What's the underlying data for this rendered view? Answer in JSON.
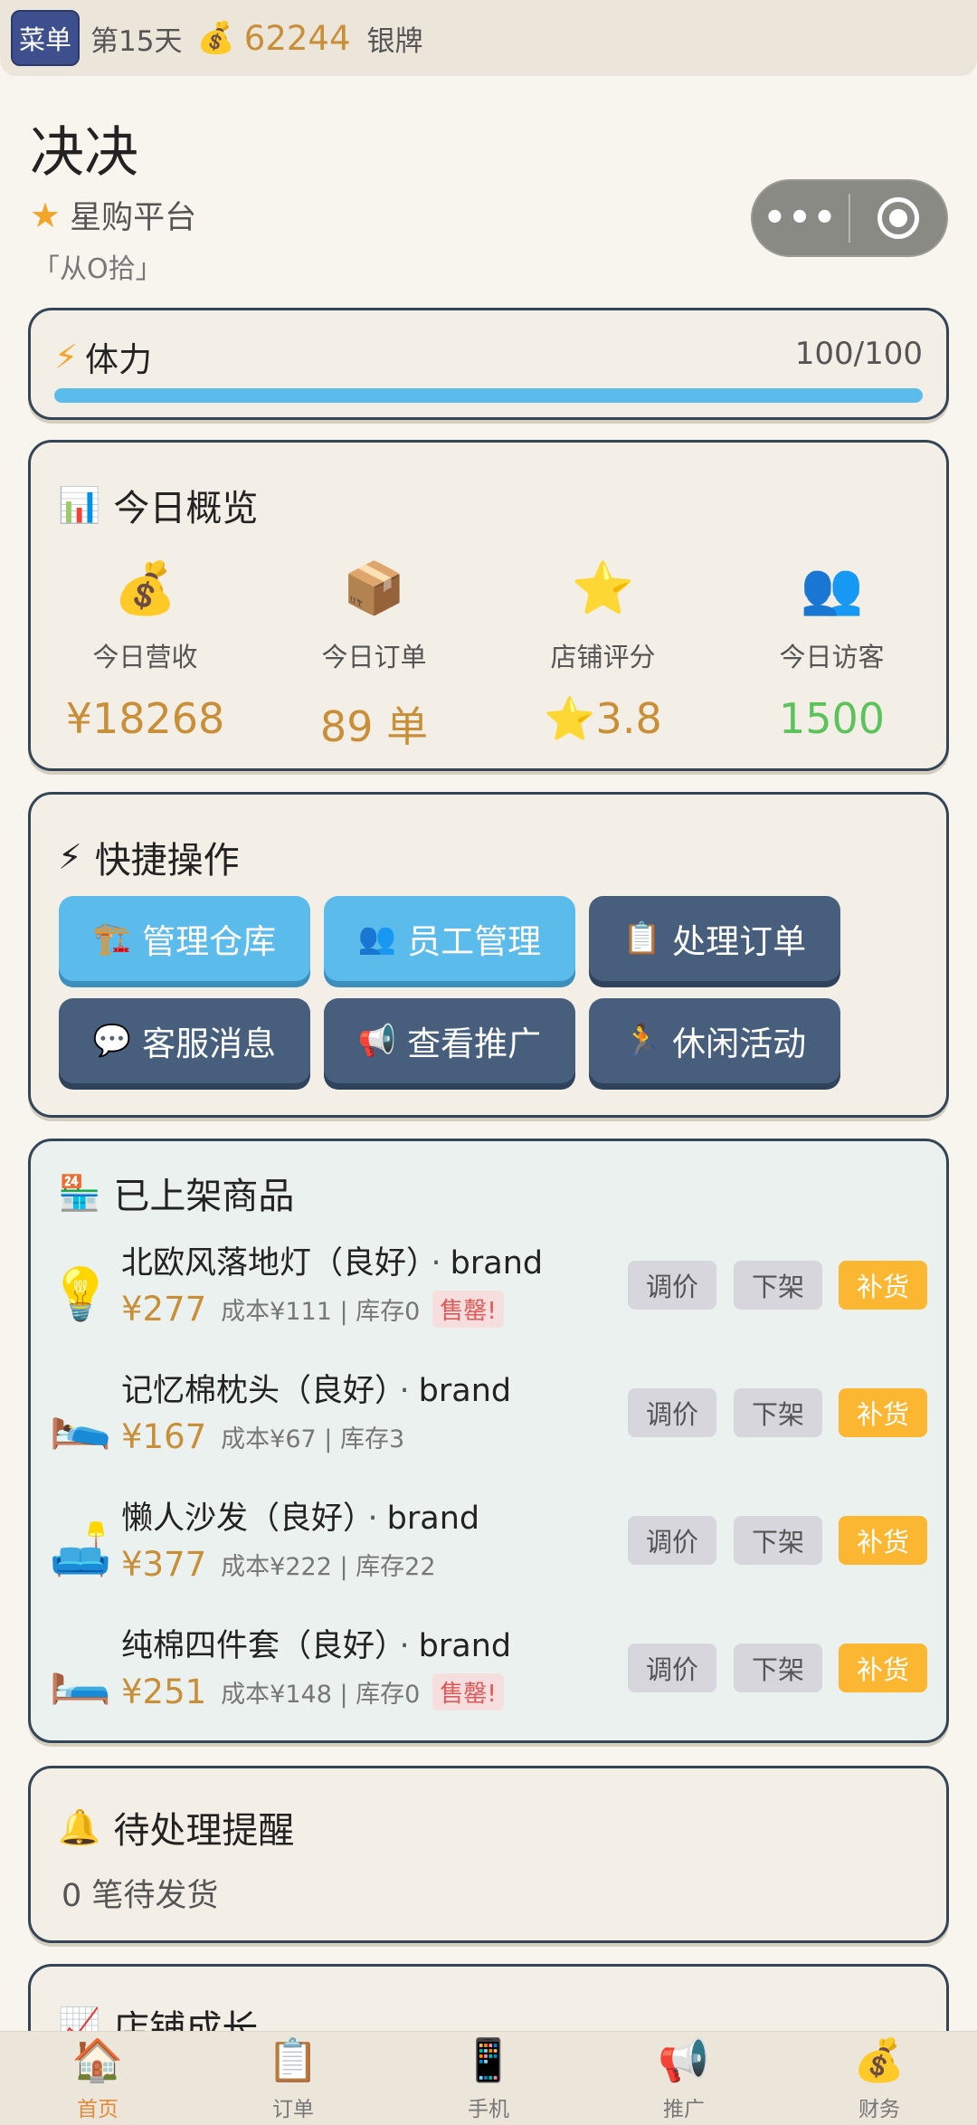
{
  "topbar": {
    "menu": "菜单",
    "day": "第15天",
    "coin_icon": "💰",
    "coins": "62244",
    "rank": "银牌"
  },
  "header": {
    "shop_name": "决决",
    "platform": "星购平台",
    "motto": "「从O拾」"
  },
  "stamina": {
    "label": "体力",
    "value": "100/100",
    "fraction": 1.0,
    "bar_color": "#5bbcec"
  },
  "overview": {
    "title": "今日概览",
    "stats": [
      {
        "icon": "💰",
        "label": "今日营收",
        "value": "¥18268"
      },
      {
        "icon": "📦",
        "label": "今日订单",
        "value": "89 单"
      },
      {
        "icon": "⭐",
        "label": "店铺评分",
        "value": "⭐3.8"
      },
      {
        "icon": "👥",
        "label": "今日访客",
        "value": "1500"
      }
    ]
  },
  "quick": {
    "title": "快捷操作",
    "buttons": [
      {
        "icon": "🏗️",
        "label": "管理仓库"
      },
      {
        "icon": "👥",
        "label": "员工管理"
      },
      {
        "icon": "📋",
        "label": "处理订单"
      },
      {
        "icon": "💬",
        "label": "客服消息"
      },
      {
        "icon": "📢",
        "label": "查看推广"
      },
      {
        "icon": "🏃",
        "label": "休闲活动"
      }
    ]
  },
  "products": {
    "title": "已上架商品",
    "actions": {
      "adjust": "调价",
      "delist": "下架",
      "restock": "补货"
    },
    "items": [
      {
        "icon": "💡",
        "name": "北欧风落地灯（良好）",
        "dot": "·",
        "brand": "brand",
        "price": "¥277",
        "meta": "成本¥111 | 库存0",
        "badge": "售罄!"
      },
      {
        "icon": "🛌",
        "name": "记忆棉枕头（良好）",
        "dot": "·",
        "brand": "brand",
        "price": "¥167",
        "meta": "成本¥67 | 库存3",
        "badge": ""
      },
      {
        "icon": "🛋️",
        "name": "懒人沙发（良好）",
        "dot": "·",
        "brand": "brand",
        "price": "¥377",
        "meta": "成本¥222 | 库存22",
        "badge": ""
      },
      {
        "icon": "🛏️",
        "name": "纯棉四件套（良好）",
        "dot": "·",
        "brand": "brand",
        "price": "¥251",
        "meta": "成本¥148 | 库存0",
        "badge": "售罄!"
      }
    ]
  },
  "reminders": {
    "title": "待处理提醒",
    "pending": "0 笔待发货"
  },
  "growth": {
    "title": "店铺成长"
  },
  "nav": [
    {
      "icon": "🏠",
      "label": "首页"
    },
    {
      "icon": "📋",
      "label": "订单"
    },
    {
      "icon": "📱",
      "label": "手机"
    },
    {
      "icon": "📢",
      "label": "推广"
    },
    {
      "icon": "💰",
      "label": "财务"
    }
  ]
}
